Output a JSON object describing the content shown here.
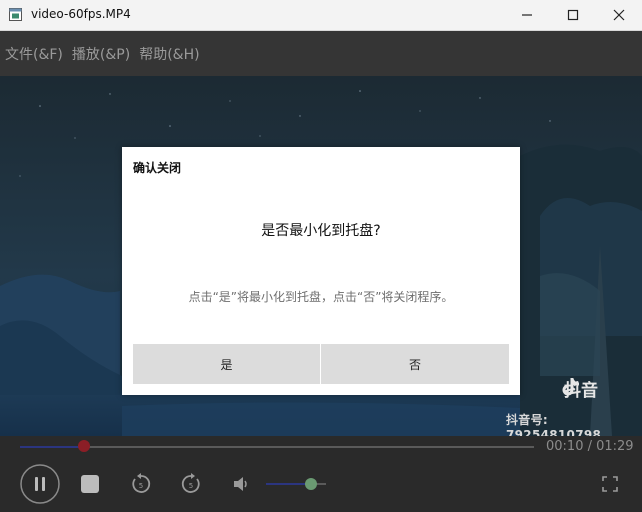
{
  "window": {
    "title": "video-60fps.MP4"
  },
  "menu": {
    "items": [
      "文件(&F)",
      "播放(&P)",
      "帮助(&H)"
    ]
  },
  "watermark": {
    "brand": "抖音",
    "account": "抖音号: 79254810798"
  },
  "dialog": {
    "title": "确认关闭",
    "question": "是否最小化到托盘?",
    "detail": "点击“是”将最小化到托盘，点击“否”将关闭程序。",
    "yes_label": "是",
    "no_label": "否"
  },
  "player": {
    "time_readout": "00:10 / 01:29",
    "progress_fraction": 0.125,
    "volume_fraction": 0.75
  },
  "colors": {
    "progress_fill": "#2b3580",
    "progress_knob": "#8b1e26",
    "volume_knob": "#6a9a72",
    "menubar_bg": "#353535",
    "controls_bg": "#2a2a2a"
  },
  "icons": {
    "app": "app-window-icon",
    "minimize": "minimize-icon",
    "maximize": "maximize-icon",
    "close": "close-icon",
    "pause": "pause-icon",
    "stop": "stop-icon",
    "rewind": "rewind-5-icon",
    "forward": "forward-5-icon",
    "volume": "volume-icon",
    "fullscreen": "fullscreen-icon"
  }
}
